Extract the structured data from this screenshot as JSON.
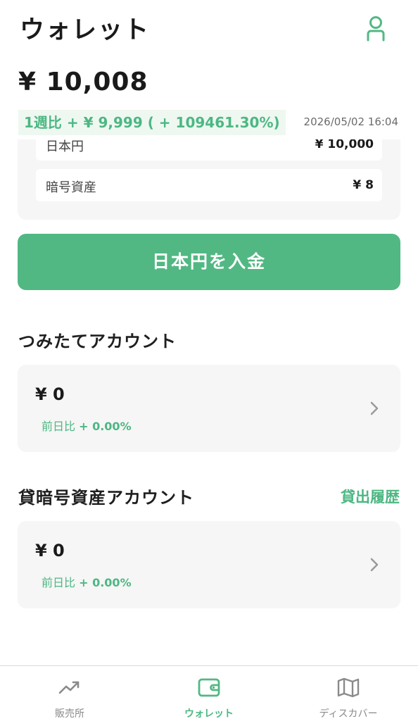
{
  "header": {
    "title": "ウォレット"
  },
  "balance": {
    "total": "¥ 10,008"
  },
  "change": {
    "weekly": "1週比 + ¥ 9,999 ( + 109461.30%)",
    "timestamp": "2026/05/02 16:04"
  },
  "summary": {
    "jpy": {
      "label": "日本円",
      "value": "¥ 10,000"
    },
    "crypto": {
      "label": "暗号資産",
      "value": "¥ 8"
    }
  },
  "deposit_button": "日本円を入金",
  "tsumitate": {
    "title": "つみたてアカウント",
    "amount": "¥ 0",
    "day_label": "前日比",
    "day_value": "+ 0.00%"
  },
  "lending": {
    "title": "貸暗号資産アカウント",
    "history_link": "貸出履歴",
    "amount": "¥ 0",
    "day_label": "前日比",
    "day_value": "+ 0.00%"
  },
  "tabbar": {
    "items": [
      {
        "label": "販売所",
        "icon": "trending-up-icon"
      },
      {
        "label": "ウォレット",
        "icon": "wallet-icon"
      },
      {
        "label": "ディスカバー",
        "icon": "map-icon"
      }
    ],
    "active_index": 1
  },
  "colors": {
    "accent": "#52b883",
    "accent_text": "#4db783",
    "card_bg": "#f5f6f5",
    "badge_bg": "#eef8f1"
  }
}
